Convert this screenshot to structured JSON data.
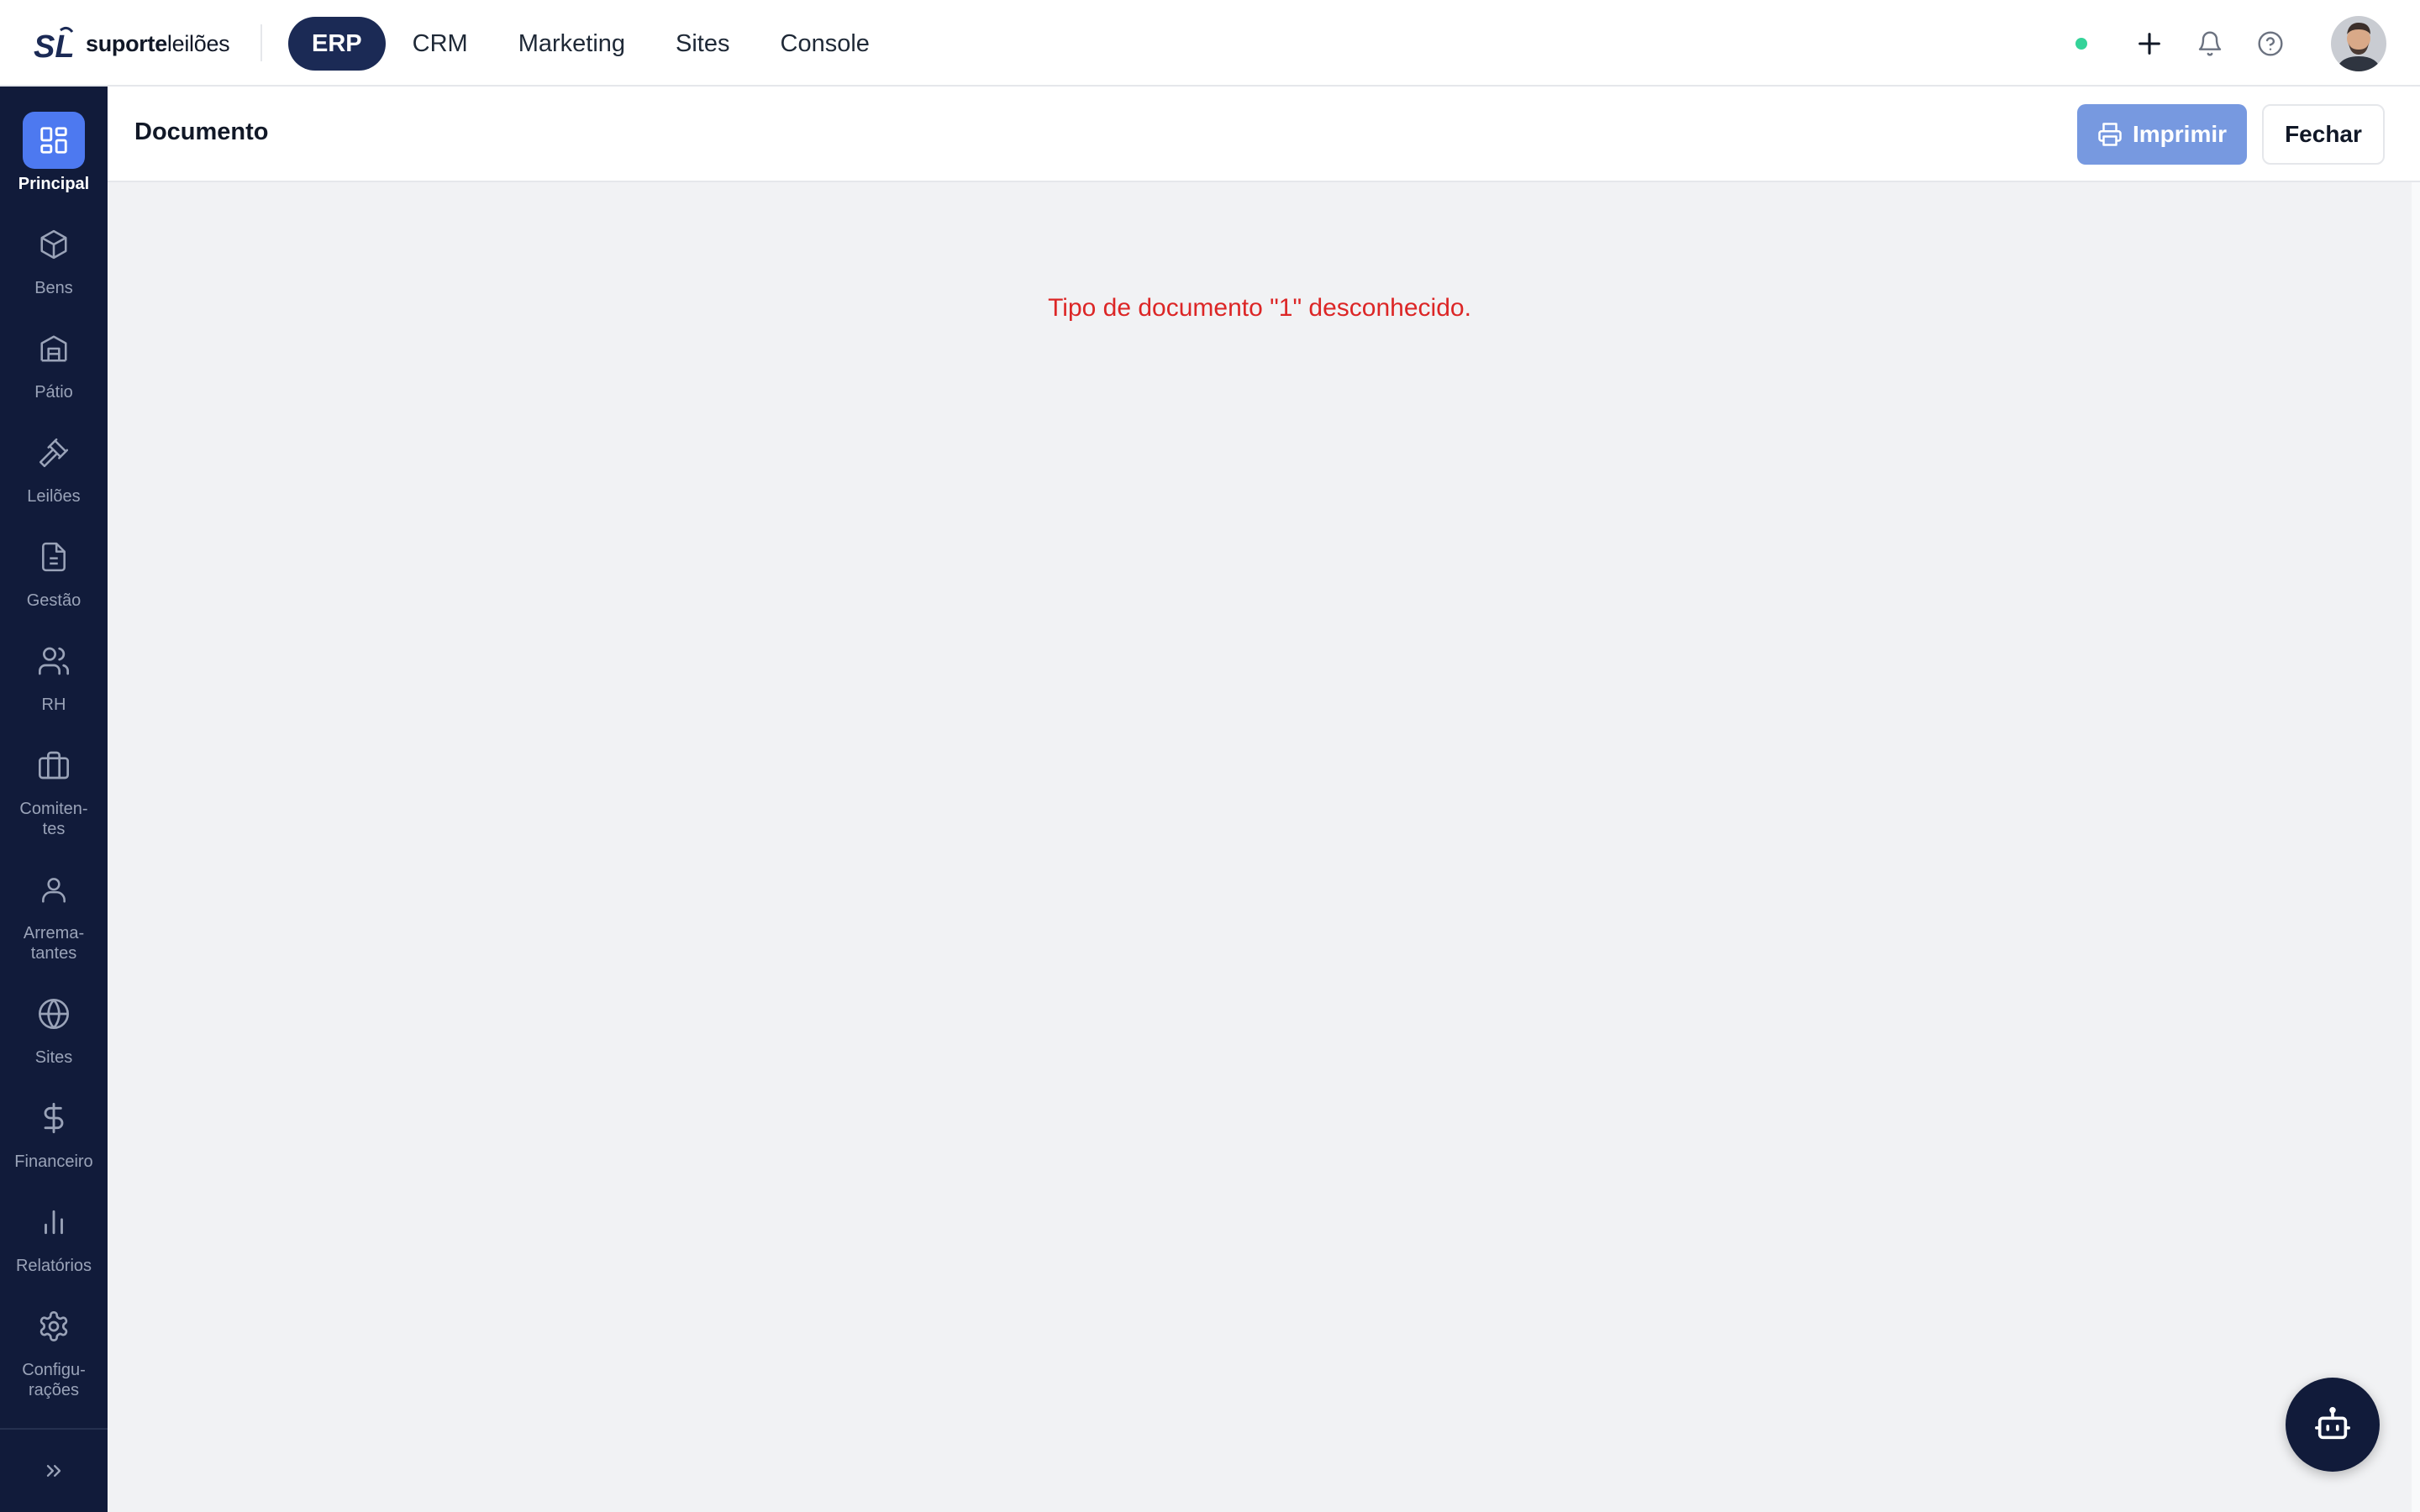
{
  "app": {
    "logo": {
      "bold": "suporte",
      "light": "leilões",
      "mark": "SL"
    }
  },
  "topnav": {
    "items": [
      {
        "label": "ERP",
        "active": true
      },
      {
        "label": "CRM",
        "active": false
      },
      {
        "label": "Marketing",
        "active": false
      },
      {
        "label": "Sites",
        "active": false
      },
      {
        "label": "Console",
        "active": false
      }
    ],
    "status_color": "#34d399",
    "icons": [
      "plus-icon",
      "bell-icon",
      "help-circle-icon"
    ]
  },
  "sidebar": {
    "items": [
      {
        "label": "Principal",
        "icon": "layout-grid-icon",
        "active": true
      },
      {
        "label": "Bens",
        "icon": "box-icon",
        "active": false
      },
      {
        "label": "Pátio",
        "icon": "warehouse-icon",
        "active": false
      },
      {
        "label": "Leilões",
        "icon": "gavel-icon",
        "active": false
      },
      {
        "label": "Gestão",
        "icon": "file-text-icon",
        "active": false
      },
      {
        "label": "RH",
        "icon": "users-icon",
        "active": false
      },
      {
        "label": "Comiten-\ntes",
        "icon": "briefcase-icon",
        "active": false
      },
      {
        "label": "Arrema-\ntantes",
        "icon": "user-icon",
        "active": false
      },
      {
        "label": "Sites",
        "icon": "globe-icon",
        "active": false
      },
      {
        "label": "Financeiro",
        "icon": "dollar-icon",
        "active": false
      },
      {
        "label": "Relatórios",
        "icon": "bar-chart-icon",
        "active": false
      },
      {
        "label": "Configu-\nrações",
        "icon": "gear-icon",
        "active": false
      }
    ],
    "expand_icon": "chevrons-right-icon"
  },
  "document": {
    "title": "Documento",
    "print_label": "Imprimir",
    "close_label": "Fechar",
    "error_message": "Tipo de documento \"1\" desconhecido."
  },
  "colors": {
    "sidebar_bg": "#111b3a",
    "accent": "#4d79f0",
    "nav_active": "#1b2a55",
    "error": "#dc2626",
    "print_button": "#7799e0"
  },
  "fab": {
    "icon": "bot-icon"
  }
}
